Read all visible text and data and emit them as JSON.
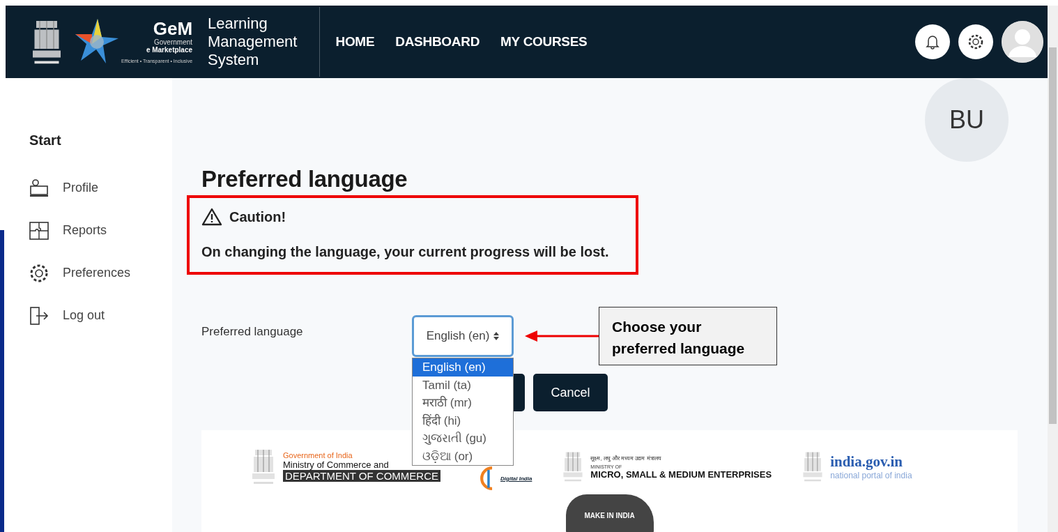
{
  "header": {
    "brand": {
      "name": "GeM",
      "line1": "Government",
      "line2": "e Marketplace",
      "tagline": "Efficient • Transparent • Inclusive"
    },
    "app_title": [
      "Learning",
      "Management",
      "System"
    ],
    "nav": [
      {
        "label": "HOME"
      },
      {
        "label": "DASHBOARD"
      },
      {
        "label": "MY COURSES"
      }
    ]
  },
  "sidebar": {
    "heading": "Start",
    "items": [
      {
        "label": "Profile",
        "kind": "profile"
      },
      {
        "label": "Reports",
        "kind": "reports"
      },
      {
        "label": "Preferences",
        "kind": "preferences"
      },
      {
        "label": "Log out",
        "kind": "logout"
      }
    ]
  },
  "user_initials": "BU",
  "page_title": "Preferred language",
  "caution": {
    "title": "Caution!",
    "message": "On changing the language, your current progress will be lost."
  },
  "form": {
    "label": "Preferred language",
    "value": "English (en)",
    "options": [
      {
        "label": "English (en)",
        "selected": true
      },
      {
        "label": "Tamil (ta)",
        "selected": false
      },
      {
        "label": "मराठी (mr)",
        "selected": false
      },
      {
        "label": "हिंदी (hi)",
        "selected": false
      },
      {
        "label": "ગુજરાતી (gu)",
        "selected": false
      },
      {
        "label": "ଓଡ଼ିଆ (or)",
        "selected": false
      }
    ],
    "cancel": "Cancel"
  },
  "callout": {
    "text": "Choose your preferred language"
  },
  "footer": {
    "commerce": {
      "top": "Government of India",
      "middle": "Ministry of Commerce and",
      "bottom": "DEPARTMENT OF COMMERCE"
    },
    "digital": "Digital India",
    "msme": {
      "hindi": "सूक्ष्म, लघु और मध्यम उद्यम मंत्रालय",
      "top": "MINISTRY OF",
      "name": "MICRO, SMALL & MEDIUM ENTERPRISES"
    },
    "portal": {
      "name": "india.gov.in",
      "sub": "national portal of india"
    },
    "make_in_india": "MAKE IN INDIA"
  }
}
